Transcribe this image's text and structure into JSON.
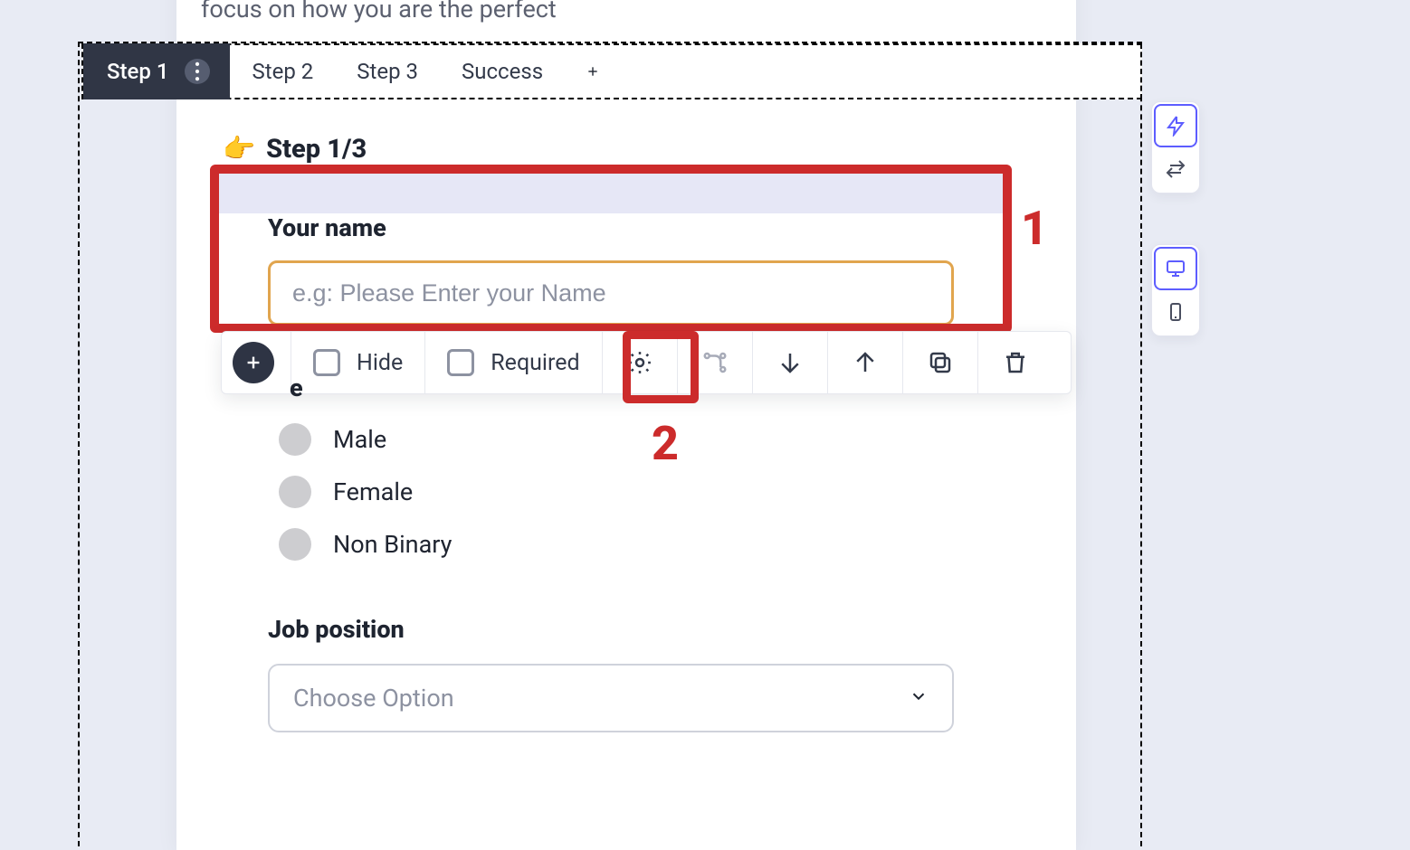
{
  "pretext": "focus on how you are the perfect",
  "tabs": {
    "active": "Step 1",
    "others": [
      "Step 2",
      "Step 3",
      "Success"
    ]
  },
  "step": {
    "heading_prefix": "👉",
    "heading": "Step 1/3"
  },
  "field_name": {
    "label": "Your name",
    "placeholder": "e.g: Please Enter your Name"
  },
  "fragment_letter": "e",
  "toolbar": {
    "hide": "Hide",
    "required": "Required"
  },
  "callout_numbers": {
    "one": "1",
    "two": "2"
  },
  "radios": [
    "Male",
    "Female",
    "Non Binary"
  ],
  "field_job": {
    "label": "Job position",
    "placeholder": "Choose Option"
  },
  "side": {
    "lightning": "lightning-icon",
    "swap": "swap-icon",
    "desktop": "desktop-icon",
    "mobile": "mobile-icon"
  }
}
